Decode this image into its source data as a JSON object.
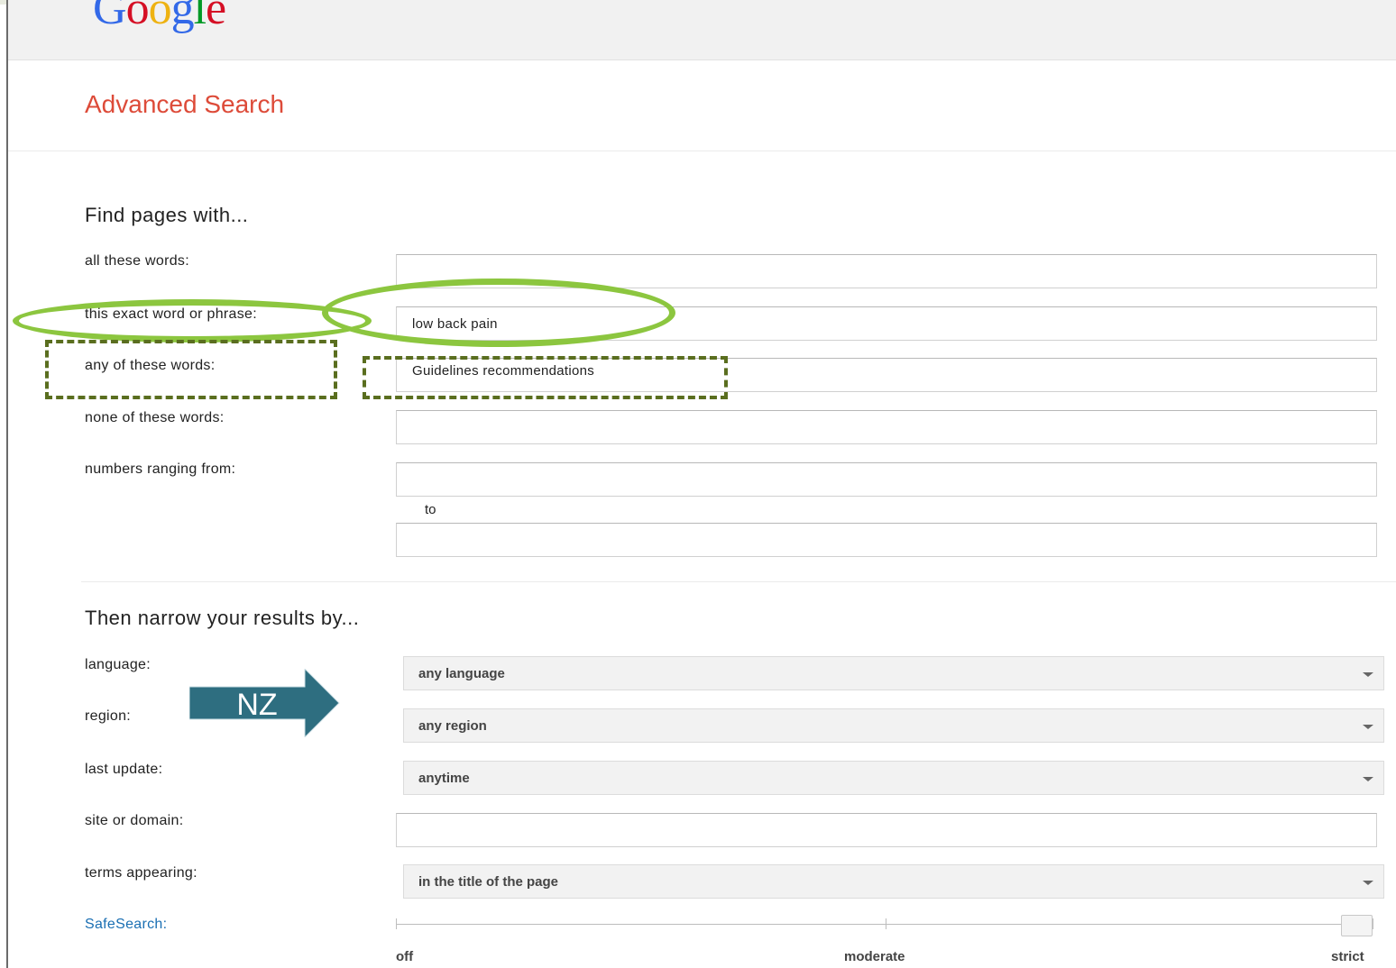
{
  "header": {
    "logo": "Google"
  },
  "page_title": "Advanced Search",
  "find_section": {
    "heading": "Find pages with...",
    "fields": [
      {
        "label": "all these words:",
        "value": ""
      },
      {
        "label": "this exact word or phrase:",
        "value": "low back pain"
      },
      {
        "label": "any of these words:",
        "value": "Guidelines recommendations"
      },
      {
        "label": "none of these words:",
        "value": ""
      },
      {
        "label": "numbers ranging from:",
        "value": ""
      }
    ],
    "to_label": "to",
    "to_value": ""
  },
  "narrow_section": {
    "heading": "Then narrow your results by...",
    "language": {
      "label": "language:",
      "value": "any language"
    },
    "region": {
      "label": "region:",
      "value": "any region"
    },
    "last_update": {
      "label": "last update:",
      "value": "anytime"
    },
    "site": {
      "label": "site or domain:",
      "value": ""
    },
    "terms": {
      "label": "terms appearing:",
      "value": "in the title of the page"
    },
    "safesearch": {
      "label": "SafeSearch:",
      "options": [
        "off",
        "moderate",
        "strict"
      ],
      "selected": "strict"
    }
  },
  "annotation": {
    "arrow_label": "NZ",
    "arrow_color": "#2e6e80",
    "highlight_color": "#8cc63f",
    "dash_color": "#5a6e1f"
  }
}
